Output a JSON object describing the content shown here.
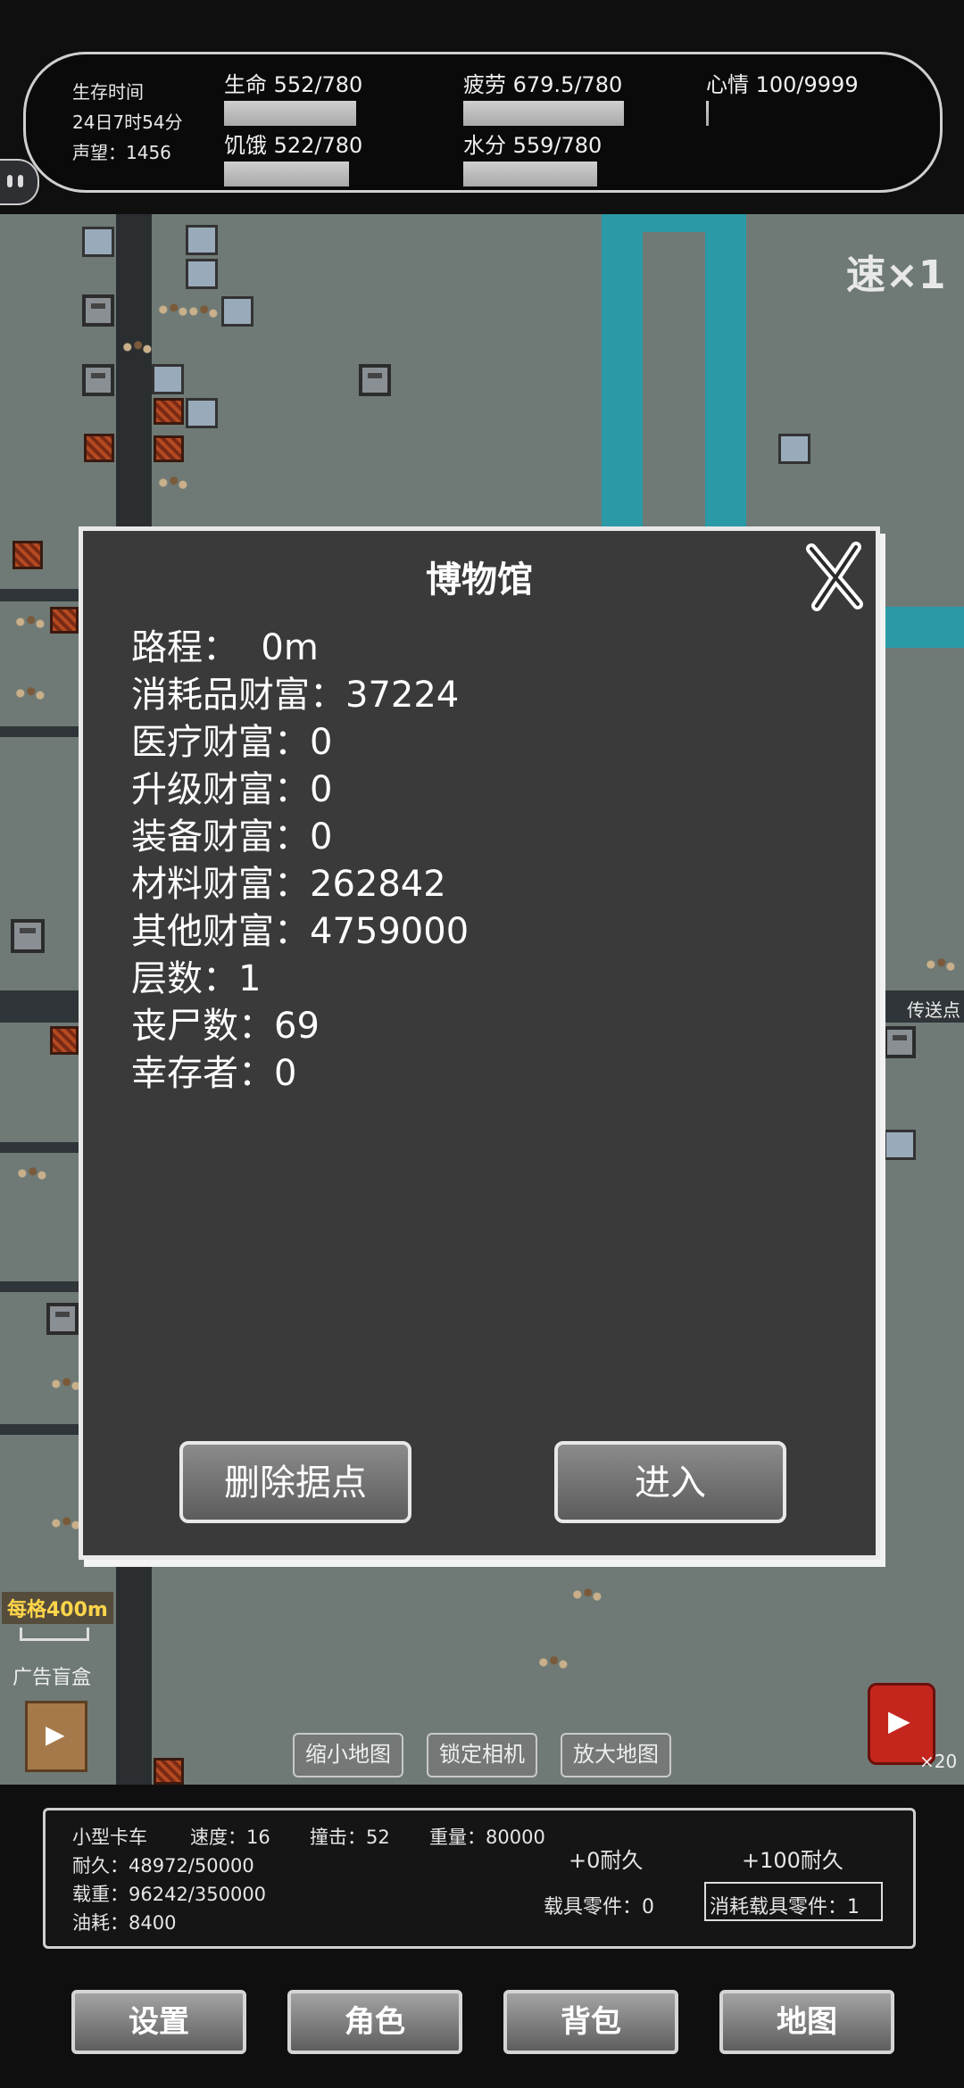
{
  "status": {
    "survival_label": "生存时间",
    "survival_time": "24日7时54分",
    "reputation": "声望：1456",
    "life": "生命 552/780",
    "fatigue": "疲劳 679.5/780",
    "mood": "心情 100/9999",
    "hunger": "饥饿 522/780",
    "water": "水分 559/780",
    "life_fraction": 0.71,
    "fatigue_fraction": 0.87,
    "hunger_fraction": 0.67,
    "water_fraction": 0.72,
    "mood_fraction": 0.01
  },
  "speed": "速×1",
  "modal": {
    "title": "博物馆",
    "rows": [
      "路程：  0m",
      "消耗品财富：37224",
      "医疗财富：0",
      "升级财富：0",
      "装备财富：0",
      "材料财富：262842",
      "其他财富：4759000",
      "层数：1",
      "丧尸数：69",
      "幸存者：0"
    ],
    "delete_button": "删除据点",
    "enter_button": "进入"
  },
  "map": {
    "scale_label": "每格400m",
    "ad_box_label": "广告盲盒",
    "portal_label": "传送点",
    "zoom_out": "缩小地图",
    "lock_camera": "锁定相机",
    "zoom_in": "放大地图",
    "fuel_count": "×20"
  },
  "vehicle": {
    "name": "小型卡车",
    "speed": "速度：16",
    "impact": "撞击：52",
    "weight": "重量：80000",
    "durability": "耐久：48972/50000",
    "load": "载重：96242/350000",
    "fuel": "油耗：8400",
    "plus0": "+0耐久",
    "plus100": "+100耐久",
    "parts": "载具零件：0",
    "consume_parts": "消耗载具零件：1"
  },
  "nav": {
    "settings": "设置",
    "character": "角色",
    "backpack": "背包",
    "map": "地图"
  }
}
